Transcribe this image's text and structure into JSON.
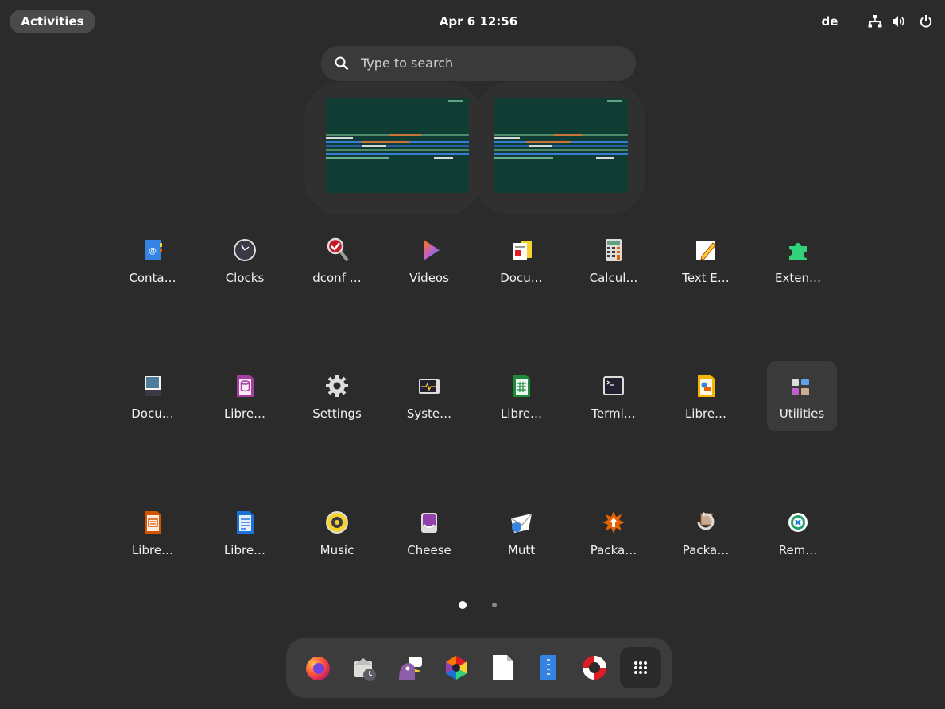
{
  "top_bar": {
    "activities_label": "Activities",
    "clock": "Apr 6  12:56",
    "keyboard_layout": "de",
    "tray_icons": [
      "network-icon",
      "volume-icon",
      "power-icon"
    ]
  },
  "search": {
    "placeholder": "Type to search",
    "icon": "search-icon"
  },
  "workspaces": [
    {
      "icon": "workspace-thumbnail"
    },
    {
      "icon": "workspace-thumbnail"
    }
  ],
  "app_grid": {
    "apps": [
      {
        "label": "Conta…",
        "icon": "contacts-icon"
      },
      {
        "label": "Clocks",
        "icon": "clocks-icon"
      },
      {
        "label": "dconf …",
        "icon": "dconf-editor-icon"
      },
      {
        "label": "Videos",
        "icon": "videos-icon"
      },
      {
        "label": "Docu…",
        "icon": "document-viewer-icon"
      },
      {
        "label": "Calcul…",
        "icon": "calculator-icon"
      },
      {
        "label": "Text E…",
        "icon": "text-editor-icon"
      },
      {
        "label": "Exten…",
        "icon": "extensions-icon"
      },
      {
        "label": "Docu…",
        "icon": "document-scanner-icon"
      },
      {
        "label": "Libre…",
        "icon": "libreoffice-base-icon"
      },
      {
        "label": "Settings",
        "icon": "settings-icon"
      },
      {
        "label": "Syste…",
        "icon": "system-monitor-icon"
      },
      {
        "label": "Libre…",
        "icon": "libreoffice-calc-icon"
      },
      {
        "label": "Termi…",
        "icon": "terminal-icon"
      },
      {
        "label": "Libre…",
        "icon": "libreoffice-draw-icon"
      },
      {
        "label": "Utilities",
        "icon": "utilities-folder-icon"
      },
      {
        "label": "Libre…",
        "icon": "libreoffice-impress-icon"
      },
      {
        "label": "Libre…",
        "icon": "libreoffice-writer-icon"
      },
      {
        "label": "Music",
        "icon": "music-icon"
      },
      {
        "label": "Cheese",
        "icon": "cheese-icon"
      },
      {
        "label": "Mutt",
        "icon": "mutt-icon"
      },
      {
        "label": "Packa…",
        "icon": "package-installer-icon"
      },
      {
        "label": "Packa…",
        "icon": "package-updater-icon"
      },
      {
        "label": "Rem…",
        "icon": "remote-desktop-icon"
      }
    ],
    "pages": {
      "current": 1,
      "total": 2
    }
  },
  "dock": {
    "items": [
      {
        "icon": "firefox-icon"
      },
      {
        "icon": "evolution-mail-icon"
      },
      {
        "icon": "pidgin-icon"
      },
      {
        "icon": "color-picker-icon"
      },
      {
        "icon": "files-icon"
      },
      {
        "icon": "archive-icon"
      },
      {
        "icon": "help-icon"
      },
      {
        "icon": "show-apps-icon"
      }
    ]
  },
  "colors": {
    "background": "#2b2b2b",
    "panel": "#3c3c3c",
    "workspace": "#103d33",
    "highlight": "#3a3a3a"
  }
}
